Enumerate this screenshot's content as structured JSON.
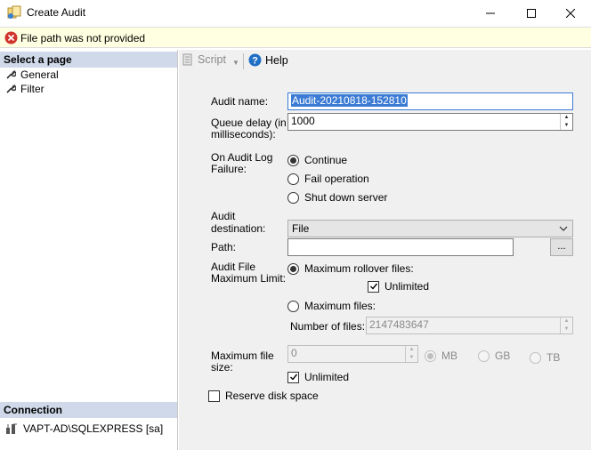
{
  "window": {
    "title": "Create Audit"
  },
  "error": {
    "message": "File path was not provided"
  },
  "left_pane": {
    "select_page_header": "Select a page",
    "pages": [
      {
        "label": "General",
        "icon": "wrench-icon"
      },
      {
        "label": "Filter",
        "icon": "wrench-icon"
      }
    ],
    "connection_header": "Connection",
    "connection": "VAPT-AD\\SQLEXPRESS [sa]"
  },
  "toolbar": {
    "script_label": "Script",
    "help_label": "Help"
  },
  "form": {
    "audit_name_label": "Audit name:",
    "audit_name_value": "Audit-20210818-152810",
    "queue_delay_label_1": "Queue delay (in",
    "queue_delay_label_2": "milliseconds):",
    "queue_delay_value": "1000",
    "on_failure_label_1": "On Audit Log",
    "on_failure_label_2": "Failure:",
    "on_failure_options": [
      {
        "label": "Continue",
        "selected": true
      },
      {
        "label": "Fail operation",
        "selected": false
      },
      {
        "label": "Shut down server",
        "selected": false
      }
    ],
    "destination_label_1": "Audit",
    "destination_label_2": "destination:",
    "destination_value": "File",
    "path_label": "Path:",
    "path_value": "",
    "browse_label": "...",
    "max_limit_label_1": "Audit File",
    "max_limit_label_2": "Maximum Limit:",
    "max_rollover_label": "Maximum rollover files:",
    "max_rollover_selected": true,
    "rollover_unlimited_label": "Unlimited",
    "rollover_unlimited_checked": true,
    "max_files_label": "Maximum files:",
    "max_files_selected": false,
    "number_of_files_label": "Number of files:",
    "number_of_files_value": "2147483647",
    "max_file_size_label_1": "Maximum file",
    "max_file_size_label_2": "size:",
    "max_file_size_value": "0",
    "size_units": [
      "MB",
      "GB",
      "TB"
    ],
    "size_unlimited_label": "Unlimited",
    "size_unlimited_checked": true,
    "reserve_disk_label": "Reserve disk space",
    "reserve_disk_checked": false
  }
}
